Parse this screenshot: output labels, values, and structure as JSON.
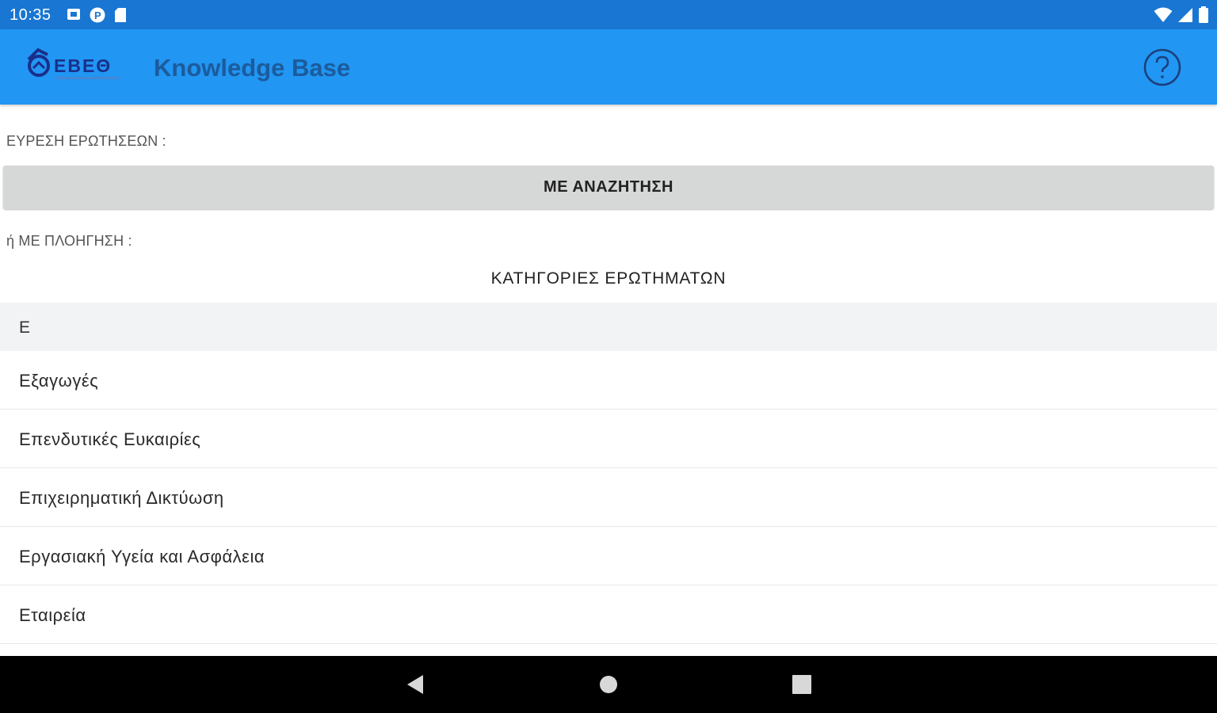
{
  "status_bar": {
    "time": "10:35",
    "left_icons": [
      "notification-square-icon",
      "app-p-icon",
      "sd-card-icon"
    ],
    "right_icons": [
      "wifi-icon",
      "cell-signal-icon",
      "battery-icon"
    ]
  },
  "app_bar": {
    "logo_text": "ΕΒΕΘ",
    "title": "Knowledge Base",
    "help_icon": "help-circle-icon"
  },
  "search_section": {
    "label": "ΕΥΡΕΣΗ ΕΡΩΤΗΣΕΩΝ :",
    "button_label": "ΜΕ ΑΝΑΖΗΤΗΣΗ"
  },
  "navigation_section": {
    "label": "ή ΜΕ ΠΛΟΗΓΗΣΗ :",
    "categories_title": "ΚΑΤΗΓΟΡΙΕΣ ΕΡΩΤΗΜΑΤΩΝ"
  },
  "category_list": {
    "group_letter": "Ε",
    "items": [
      {
        "label": "Εξαγωγές"
      },
      {
        "label": "Επενδυτικές Ευκαιρίες"
      },
      {
        "label": "Επιχειρηματική Δικτύωση"
      },
      {
        "label": "Εργασιακή Υγεία και Ασφάλεια"
      },
      {
        "label": "Εταιρεία"
      }
    ]
  },
  "nav_bar": {
    "buttons": [
      "back-icon",
      "home-icon",
      "recents-icon"
    ]
  },
  "colors": {
    "status_bar": "#1976d2",
    "app_bar": "#2196f3",
    "title_text": "#1c5b9c",
    "button_bg": "#d6d7d7",
    "group_header_bg": "#f2f3f4"
  }
}
